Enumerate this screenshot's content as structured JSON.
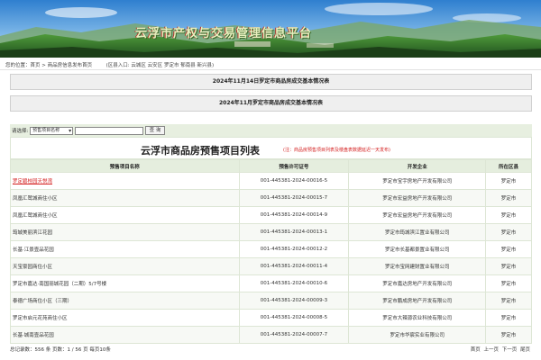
{
  "header": {
    "title": "云浮市产权与交易管理信息平台"
  },
  "breadcrumb": {
    "prefix": "您的位置：",
    "home": "首页",
    "sep": " > ",
    "current": "商品房信息发布首页",
    "region_prefix": "(区县入口:",
    "regions": [
      "云城区",
      "云安区",
      "罗定市",
      "郁南县",
      "新兴县"
    ],
    "region_suffix": ")"
  },
  "notices": [
    "2024年11月14日罗定市商品房成交基本情况表",
    "2024年11月罗定市商品房成交基本情况表"
  ],
  "search": {
    "label": "请选择:",
    "field_selected": "预售项目名称",
    "input_value": "",
    "button_label": "查 询"
  },
  "table": {
    "title": "云浮市商品房预售项目列表",
    "note": "(注：商品房预售项目列表及楼盘表数据延迟一天发布)",
    "columns": [
      "预售项目名称",
      "预售许可证号",
      "开发企业",
      "所在区县"
    ],
    "rows": [
      {
        "name": "罗定碧桂园天悦湾",
        "permit": "001-445381-2024-00016-5",
        "dev": "罗定市宝宇房地产开发有限公司",
        "area": "罗定市"
      },
      {
        "name": "凤凰汇鹭城商住小区",
        "permit": "001-445381-2024-00015-7",
        "dev": "罗定市宏益房地产开发有限公司",
        "area": "罗定市"
      },
      {
        "name": "凤凰汇鹭城商住小区",
        "permit": "001-445381-2024-00014-9",
        "dev": "罗定市宏益房地产开发有限公司",
        "area": "罗定市"
      },
      {
        "name": "筠城美丽滨江花园",
        "permit": "001-445381-2024-00013-1",
        "dev": "罗定市筠城滨江置业有限公司",
        "area": "罗定市"
      },
      {
        "name": "长基·江景壹品花园",
        "permit": "001-445381-2024-00012-2",
        "dev": "罗定市长基都景置业有限公司",
        "area": "罗定市"
      },
      {
        "name": "天宝豪园商住小区",
        "permit": "001-445381-2024-00011-4",
        "dev": "罗定市宝网建财置业有限公司",
        "area": "罗定市"
      },
      {
        "name": "罗定市嘉达·南国丽城花园（二期）5/7号楼",
        "permit": "001-445381-2024-00010-6",
        "dev": "罗定市嘉达房地产开发有限公司",
        "area": "罗定市"
      },
      {
        "name": "泰德广场商住小区（三期）",
        "permit": "001-445381-2024-00009-3",
        "dev": "罗定市鹏成房地产开发有限公司",
        "area": "罗定市"
      },
      {
        "name": "罗定市启元花苑商住小区",
        "permit": "001-445381-2024-00008-5",
        "dev": "罗定市大辣源农业科技有限公司",
        "area": "罗定市"
      },
      {
        "name": "长基·城南壹品花园",
        "permit": "001-445381-2024-00007-7",
        "dev": "罗定市华宸实业有限公司",
        "area": "罗定市"
      }
    ]
  },
  "footer": {
    "summary": "总记录数：556 条 页数：1 / 56 页 每页10条",
    "first": "首页",
    "prev": "上一页",
    "next": "下一页",
    "last": "尾页"
  }
}
